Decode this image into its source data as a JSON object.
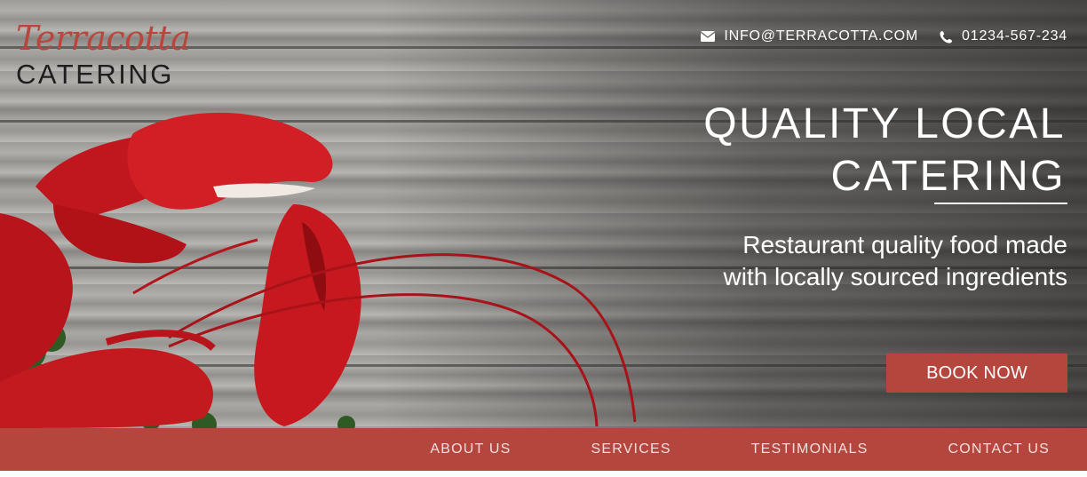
{
  "brand": {
    "script_name": "Terracotta",
    "sub_name": "CATERING"
  },
  "contact": {
    "email": "INFO@TERRACOTTA.COM",
    "email_icon": "envelope-icon",
    "phone": "01234-567-234",
    "phone_icon": "phone-icon"
  },
  "hero": {
    "headline_line1": "QUALITY LOCAL",
    "headline_line2": "CATERING",
    "tagline_line1": "Restaurant quality food made",
    "tagline_line2": "with locally sourced ingredients",
    "cta_label": "BOOK NOW",
    "background": "lobster-on-wood-photo"
  },
  "nav": {
    "items": [
      {
        "label": "ABOUT US"
      },
      {
        "label": "SERVICES"
      },
      {
        "label": "TESTIMONIALS"
      },
      {
        "label": "CONTACT US"
      }
    ]
  },
  "colors": {
    "brand_red": "#b5463d",
    "logo_red": "#b9463c",
    "text_light": "#ffffff"
  }
}
